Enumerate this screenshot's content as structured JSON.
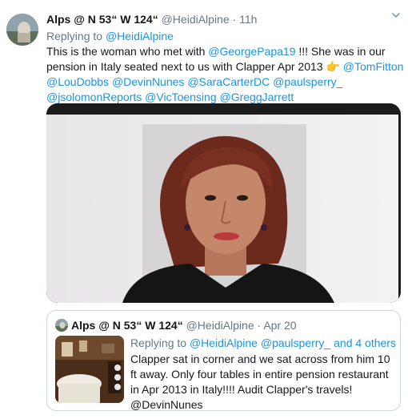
{
  "tweet": {
    "author_name": "Alps @ N 53“ W 124“",
    "author_handle": "@HeidiAlpine",
    "separator": "·",
    "time": "11h",
    "replying_to_label": "Replying to",
    "replying_to_handle": "@HeidiAlpine",
    "body_part1": "This is the woman who met with ",
    "mention_george": "@GeorgePapa19",
    "body_part2": " !!! She was in our pension in Italy seated next to us with Clapper Apr 2013 ",
    "pointing_emoji": "👉",
    "body_space": "  ",
    "mentions": [
      "@TomFitton",
      "@LouDobbs",
      "@DevinNunes",
      "@SaraCarterDC",
      "@paulsperry_",
      "@jsolomonReports",
      "@VicToensing",
      "@GreggJarrett"
    ]
  },
  "quote": {
    "author_name": "Alps @ N 53“ W 124“",
    "author_handle": "@HeidiAlpine",
    "separator": "·",
    "time": "Apr 20",
    "replying_to_label": "Replying to",
    "replying_to_handles": "@HeidiAlpine @paulsperry_",
    "replying_to_others": "and 4 others",
    "body": "Clapper sat in corner and we sat across from him 10 ft away. Only four tables in entire pension restaurant in Apr 2013 in Italy!!!!   Audit Clapper's travels!  ",
    "body_mention": "@DevinNunes"
  },
  "icons": {
    "caret": "chevron-down-icon",
    "avatar": "profile-avatar",
    "photo": "woman-portrait-photo",
    "thumbnail": "restaurant-interior-photo"
  },
  "colors": {
    "link": "#1b95e0",
    "muted": "#657786",
    "text": "#14171a",
    "border": "#ccd6dd"
  }
}
